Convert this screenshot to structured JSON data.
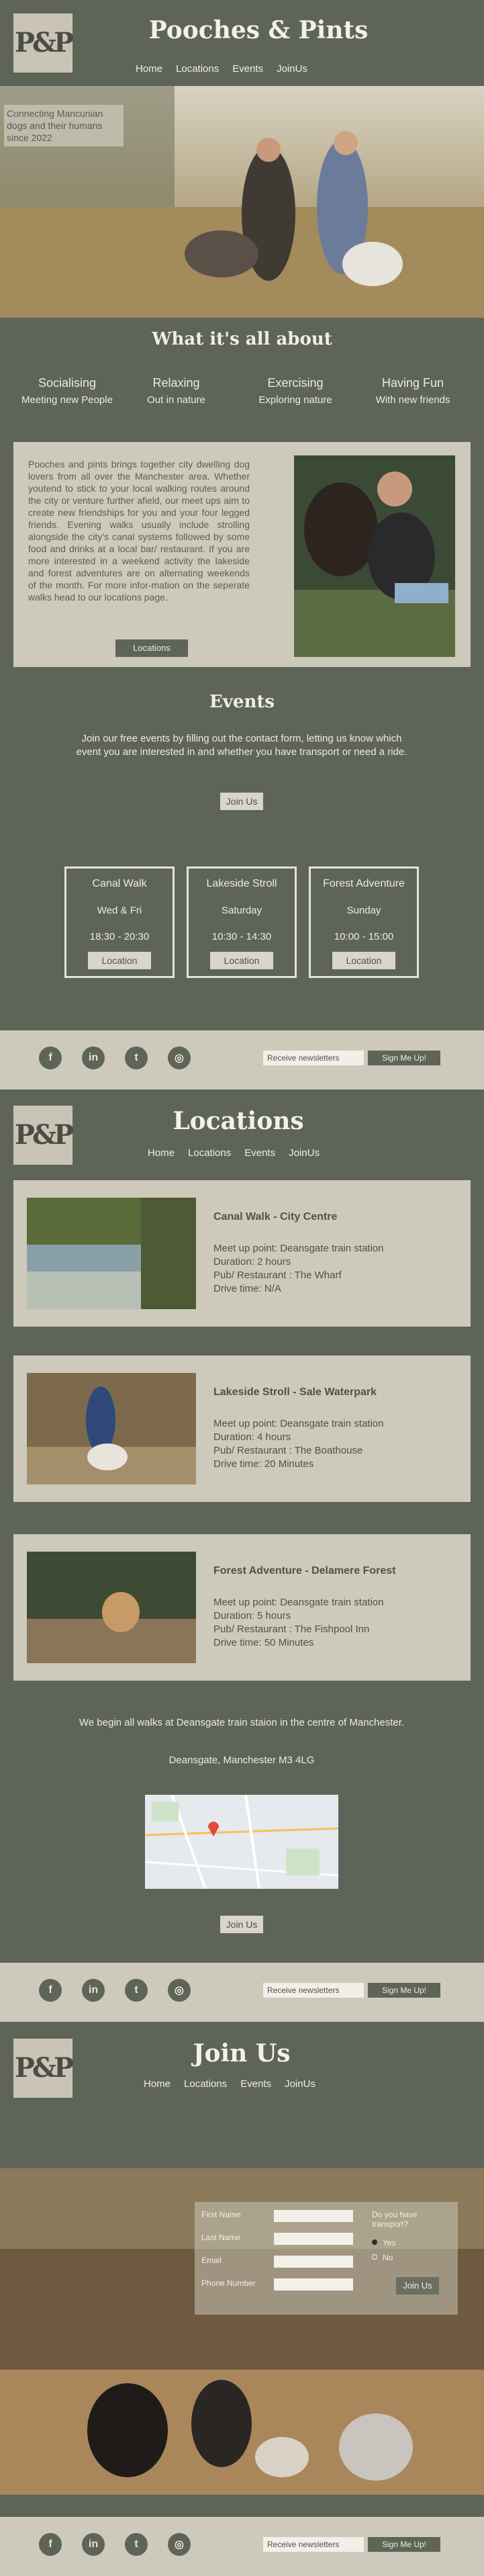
{
  "brand": "Pooches & Pints",
  "logo_text": "P&P",
  "nav": [
    "Home",
    "Locations",
    "Events",
    "JoinUs"
  ],
  "hero_caption": "Connecting Mancunian dogs and their humans since 2022",
  "about": {
    "title": "What it's all about",
    "features": [
      {
        "title": "Socialising",
        "sub": "Meeting new People"
      },
      {
        "title": "Relaxing",
        "sub": "Out in nature"
      },
      {
        "title": "Exercising",
        "sub": "Exploring nature"
      },
      {
        "title": "Having Fun",
        "sub": "With new friends"
      }
    ],
    "body": "Pooches and pints brings together city dwelling dog lovers from all over the Manchester area. Whether youtend to stick to your local walking routes around the city or venture further afield, our meet ups aim to create new friendships for you and your four legged friends. Evening walks usually include strolling alongside the city's canal systems followed by some food and drinks at a local bar/ restaurant. If you are more interested in a weekend activity the lakeside and forest adventures are on alternating weekends of the month. For more infor-mation on the seperate walks head to our locations page.",
    "button": "Locations"
  },
  "events": {
    "title": "Events",
    "intro": "Join our free events by filling out the contact form, letting us know which event you are interested in and whether you have transport or need a ride.",
    "join_button": "Join Us",
    "items": [
      {
        "name": "Canal Walk",
        "days": "Wed & Fri",
        "hours": "18:30 - 20:30",
        "button": "Location"
      },
      {
        "name": "Lakeside Stroll",
        "days": "Saturday",
        "hours": "10:30 - 14:30",
        "button": "Location"
      },
      {
        "name": "Forest Adventure",
        "days": "Sunday",
        "hours": "10:00 - 15:00",
        "button": "Location"
      }
    ]
  },
  "footer": {
    "social": [
      {
        "icon": "facebook-icon",
        "glyph": "f"
      },
      {
        "icon": "linkedin-icon",
        "glyph": "in"
      },
      {
        "icon": "twitter-icon",
        "glyph": "t"
      },
      {
        "icon": "instagram-icon",
        "glyph": "◎"
      }
    ],
    "newsletter_label": "Receive newsletters",
    "signup_button": "Sign Me Up!"
  },
  "locations_page": {
    "title": "Locations",
    "cards": [
      {
        "title": "Canal Walk - City Centre",
        "meet": "Meet up point: Deansgate train station",
        "duration": "Duration: 2 hours",
        "pub": "Pub/ Restaurant : The Wharf",
        "drive": "Drive time: N/A"
      },
      {
        "title": "Lakeside Stroll - Sale Waterpark",
        "meet": "Meet up point: Deansgate train station",
        "duration": "Duration: 4 hours",
        "pub": "Pub/ Restaurant : The Boathouse",
        "drive": "Drive time: 20 Minutes"
      },
      {
        "title": "Forest Adventure - Delamere Forest",
        "meet": "Meet up point: Deansgate train station",
        "duration": "Duration: 5 hours",
        "pub": "Pub/ Restaurant : The Fishpool Inn",
        "drive": "Drive time: 50 Minutes"
      }
    ],
    "start_text": "We begin all walks at Deansgate train staion in the centre of Manchester.",
    "address": "Deansgate, Manchester M3 4LG",
    "join_button": "Join Us"
  },
  "join_page": {
    "title": "Join Us",
    "form": {
      "first_name": "First Name",
      "last_name": "Last Name",
      "email": "Email",
      "phone": "Phone Number",
      "transport_q": "Do you have transport?",
      "yes": "Yes",
      "no": "No",
      "submit": "Join Us"
    }
  },
  "colors": {
    "background": "#5f6458",
    "panel": "#cdc9bb",
    "text_light": "#eeeae2"
  }
}
